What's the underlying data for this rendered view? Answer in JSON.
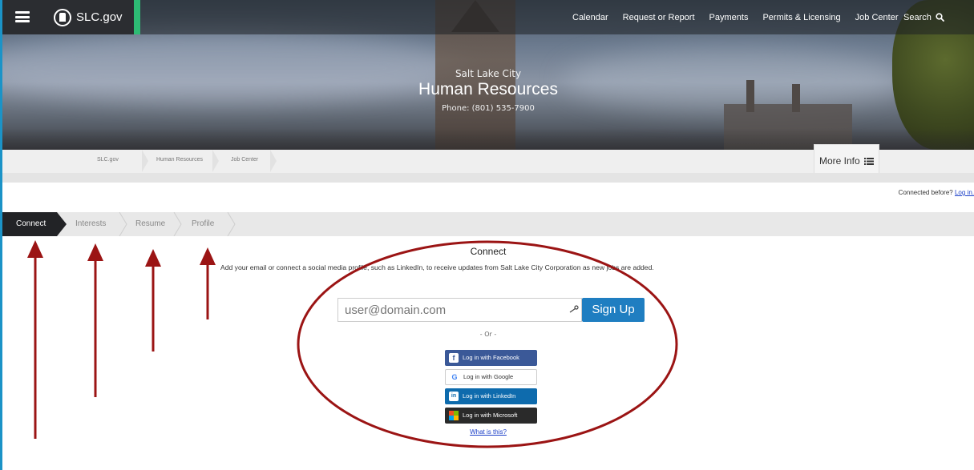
{
  "header": {
    "site_name": "SLC.gov",
    "nav": [
      "Calendar",
      "Request or Report",
      "Payments",
      "Permits & Licensing",
      "Job Center"
    ],
    "search_label": "Search"
  },
  "hero": {
    "subtitle": "Salt Lake City",
    "title": "Human Resources",
    "phone": "Phone: (801) 535-7900"
  },
  "breadcrumb": {
    "items": [
      "SLC.gov",
      "Human Resources",
      "Job Center"
    ],
    "more_info": "More Info"
  },
  "connected_before": {
    "text": "Connected before?",
    "link": "Log in."
  },
  "steps": [
    {
      "label": "Connect",
      "active": true
    },
    {
      "label": "Interests",
      "active": false
    },
    {
      "label": "Resume",
      "active": false
    },
    {
      "label": "Profile",
      "active": false
    }
  ],
  "connect": {
    "title": "Connect",
    "description": "Add your email or connect a social media profile, such as LinkedIn, to receive updates from Salt Lake City Corporation as new jobs are added.",
    "email_placeholder": "user@domain.com",
    "signup_label": "Sign Up",
    "or_label": "- Or -",
    "facebook_label": "Log in with Facebook",
    "google_label": "Log in with Google",
    "linkedin_label": "Log in with LinkedIn",
    "microsoft_label": "Log in with Microsoft",
    "what_link": "What is this?"
  },
  "colors": {
    "annotation": "#9b1414",
    "accent_green": "#2dbb74",
    "signup_blue": "#1f7ec1"
  }
}
